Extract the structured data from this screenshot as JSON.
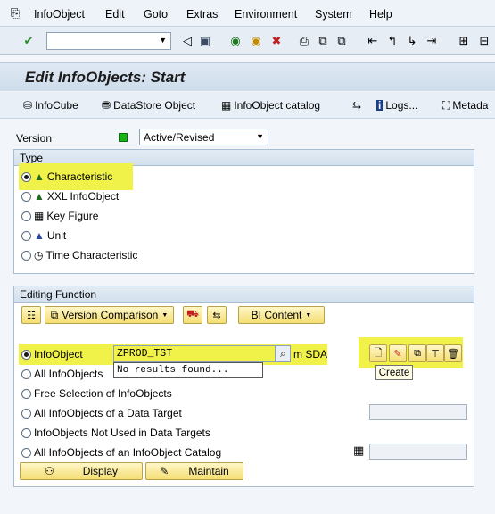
{
  "menu": [
    "InfoObject",
    "Edit",
    "Goto",
    "Extras",
    "Environment",
    "System",
    "Help"
  ],
  "page_title": "Edit InfoObjects: Start",
  "app_toolbar": {
    "infocube": "InfoCube",
    "datastore": "DataStore Object",
    "catalog": "InfoObject catalog",
    "logs": "Logs...",
    "metadata": "Metada"
  },
  "version": {
    "label": "Version",
    "value": "Active/Revised"
  },
  "type_group": {
    "title": "Type",
    "options": [
      "Characteristic",
      "XXL InfoObject",
      "Key Figure",
      "Unit",
      "Time Characteristic"
    ]
  },
  "editing": {
    "title": "Editing Function",
    "version_comparison": "Version Comparison",
    "bi_content": "BI Content",
    "options": [
      "InfoObject",
      "All InfoObjects",
      "Free Selection of InfoObjects",
      "All InfoObjects of a Data Target",
      "InfoObjects Not Used in Data Targets",
      "All InfoObjects of an InfoObject Catalog"
    ],
    "infoobject_value": "ZPROD_TST",
    "suggestion": "No results found...",
    "trailing_text": "m SDA",
    "tooltip": "Create",
    "display_btn": "Display",
    "maintain_btn": "Maintain"
  },
  "colors": {
    "highlight": "#f0f24a",
    "accent": "#1a5aa6"
  }
}
